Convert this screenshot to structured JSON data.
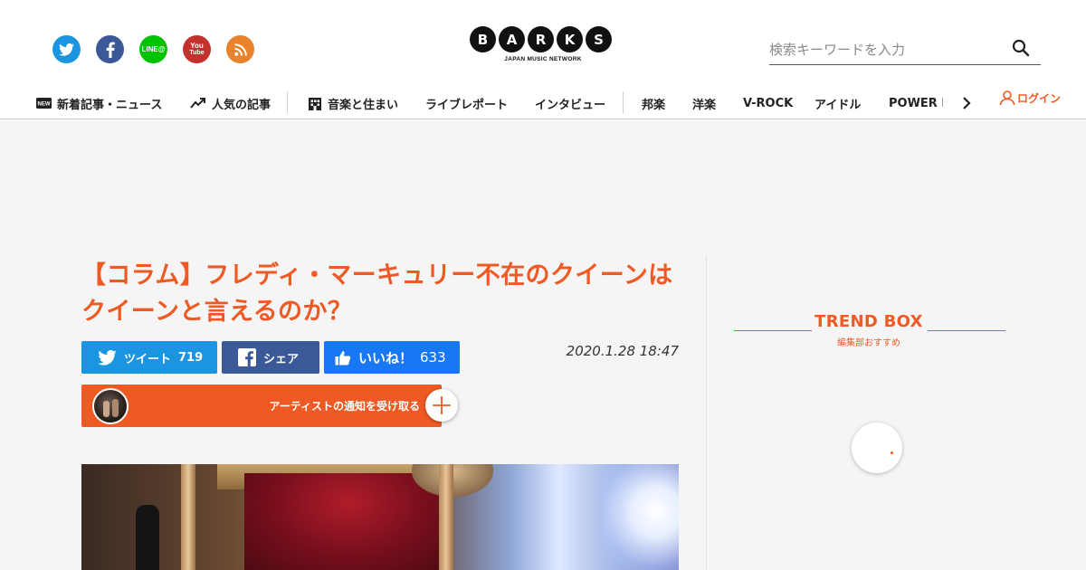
{
  "brand": {
    "logo_letters": [
      "B",
      "A",
      "R",
      "K",
      "S"
    ],
    "tagline": "JAPAN MUSIC NETWORK",
    "accent_color": "#ef5a24"
  },
  "social": [
    {
      "name": "twitter",
      "icon": "twitter-icon",
      "color": "#1b95e0"
    },
    {
      "name": "facebook",
      "icon": "facebook-icon",
      "color": "#3b5998"
    },
    {
      "name": "line",
      "icon": "line-icon",
      "color": "#00c300",
      "label": "LINE@"
    },
    {
      "name": "youtube",
      "icon": "youtube-icon",
      "color": "#c4302b",
      "label_top": "You",
      "label_bottom": "Tube"
    },
    {
      "name": "rss",
      "icon": "rss-icon",
      "color": "#e8832c"
    }
  ],
  "search": {
    "placeholder": "検索キーワードを入力",
    "value": ""
  },
  "nav": {
    "items": [
      {
        "label": "新着記事・ニュース",
        "icon": "new-badge-icon",
        "badge": "NEW"
      },
      {
        "label": "人気の記事",
        "icon": "trending-icon"
      },
      {
        "label": "音楽と住まい",
        "icon": "building-icon"
      },
      {
        "label": "ライブレポート"
      },
      {
        "label": "インタビュー"
      },
      {
        "label": "邦楽"
      },
      {
        "label": "洋楽"
      },
      {
        "label": "V-ROCK"
      },
      {
        "label": "アイドル"
      },
      {
        "label": "POWER PUSH"
      }
    ],
    "login_label": "ログイン"
  },
  "article": {
    "title": "【コラム】フレディ・マーキュリー不在のクイーンはクイーンと言えるのか？",
    "timestamp": "2020.1.28 18:47",
    "share": {
      "tweet_label": "ツイート",
      "tweet_count": "719",
      "share_label": "シェア",
      "like_label": "いいね！",
      "like_count": "633"
    },
    "follow_label": "アーティストの通知を受け取る"
  },
  "sidebar": {
    "trend_title": "TREND BOX",
    "trend_subtitle": "編集部おすすめ"
  }
}
